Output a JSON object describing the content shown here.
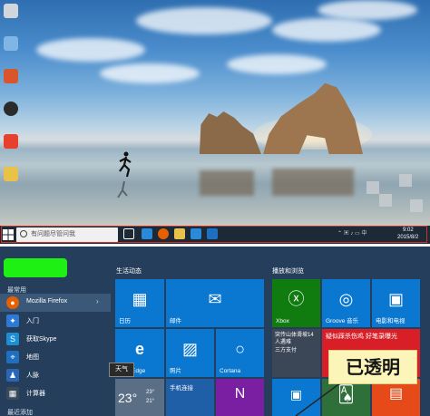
{
  "desktop": {
    "taskbar": {
      "search_placeholder": "有问题尽管问我",
      "time": "9:02",
      "date": "2015/8/2"
    }
  },
  "start_menu": {
    "most_used_label": "最常用",
    "apps": [
      {
        "label": "Mozilla Firefox",
        "icon": "firefox-icon",
        "color": "#e66000",
        "has_arrow": true
      },
      {
        "label": "入门",
        "icon": "lightbulb-icon",
        "color": "#2d7ad6",
        "has_arrow": false
      },
      {
        "label": "获取Skype",
        "icon": "skype-icon",
        "color": "#1b8fd6",
        "has_arrow": false
      },
      {
        "label": "地图",
        "icon": "map-icon",
        "color": "#1f6fc0",
        "has_arrow": false
      },
      {
        "label": "人脉",
        "icon": "people-icon",
        "color": "#2a66b8",
        "has_arrow": false
      },
      {
        "label": "计算器",
        "icon": "calculator-icon",
        "color": "#3a4a5a",
        "has_arrow": false
      }
    ],
    "recently_added_label": "最近添加",
    "tooltip": "天气",
    "sections": {
      "life": "生活动态",
      "play": "播放和浏览"
    },
    "tiles": {
      "calendar": "日历",
      "mail": "邮件",
      "edge": "rosoft Edge",
      "photos": "照片",
      "cortana": "Cortana",
      "weather_temp": "23°",
      "weather_high": "23°",
      "weather_low": "21°",
      "phone": "手机连接",
      "xbox": "Xbox",
      "groove": "Groove 音乐",
      "movies": "电影和电视",
      "news": "突传山体滑坡14人遇难",
      "news2": "三方支付",
      "feature_news": "疑似踩杀伤鸡 好笔录曝光"
    },
    "callout": "已透明"
  },
  "colors": {
    "taskbar_bg": "#1c2936",
    "start_bg": "#243e5c",
    "tile_blue": "#0a78d0",
    "xbox_green": "#107c10",
    "feature_red": "#d81e26",
    "office_orange": "#e64a19",
    "onenote_purple": "#7b1fa2",
    "highlight_green": "#1ff014",
    "callout_yellow": "#fbf5ba"
  }
}
